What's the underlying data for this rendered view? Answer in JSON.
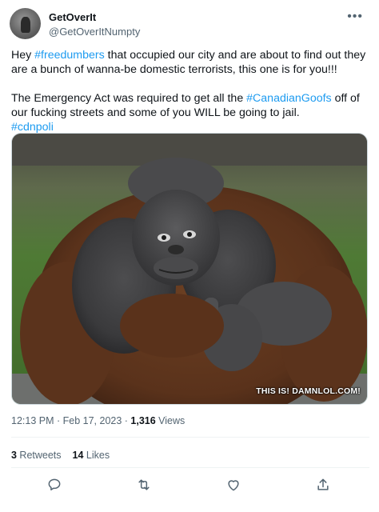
{
  "tweet": {
    "display_name": "GetOverIt",
    "handle": "@GetOverItNumpty",
    "more_icon": "more-icon",
    "line1_pre": "Hey ",
    "tag_freedumbers": "#freedumbers",
    "line1_post": "  that occupied our city and are about to find out they are a bunch of wanna-be domestic terrorists, this one is for you!!!",
    "line2_pre": "The Emergency Act was required to get all the ",
    "tag_canadiangoofs": "#CanadianGoofs",
    "line2_post": " off of our fucking streets and some of you WILL be going to jail.",
    "tag_cdnpoli": "#cdnpoli",
    "image_watermark": "THIS IS! DAMNLOL.COM!",
    "time": "12:13 PM",
    "separator": " · ",
    "date": "Feb 17, 2023",
    "views_count": "1,316",
    "views_label": " Views",
    "retweets_count": "3",
    "retweets_label": " Retweets",
    "likes_count": "14",
    "likes_label": " Likes"
  },
  "actions": {
    "reply_icon": "reply-icon",
    "retweet_icon": "retweet-icon",
    "like_icon": "heart-icon",
    "share_icon": "share-icon"
  },
  "colors": {
    "link": "#1d9bf0",
    "secondary": "#536471",
    "text": "#0f1419"
  }
}
